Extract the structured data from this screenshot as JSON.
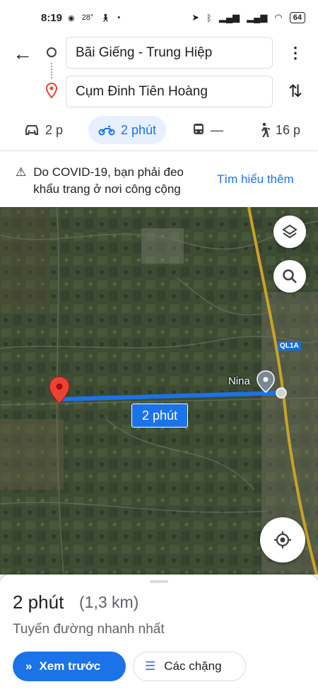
{
  "status_bar": {
    "time": "8:19",
    "temperature": "28°",
    "battery": "64"
  },
  "route": {
    "origin": "Bãi Giếng - Trung Hiệp",
    "destination": "Cụm Đinh Tiên Hoàng"
  },
  "travel_modes": [
    {
      "mode": "car",
      "label": "2 p",
      "icon": "car-icon",
      "active": false
    },
    {
      "mode": "motorbike",
      "label": "2 phút",
      "icon": "motorbike-icon",
      "active": true
    },
    {
      "mode": "transit",
      "label": "—",
      "icon": "transit-icon",
      "active": false
    },
    {
      "mode": "walk",
      "label": "16 p",
      "icon": "walk-icon",
      "active": false
    }
  ],
  "notice": {
    "text": "Do COVID-19, bạn phải đeo khẩu trang ở nơi công cộng",
    "link": "Tìm hiểu thêm"
  },
  "map": {
    "route_label": "2 phút",
    "place_label": "Nina",
    "road_label": "QL1A",
    "route_color": "#1a73e8",
    "pin_color": "#ea4335"
  },
  "summary": {
    "duration": "2 phút",
    "distance": "(1,3 km)",
    "description": "Tuyến đường nhanh nhất",
    "preview_button": "Xem trước",
    "steps_button": "Các chặng"
  }
}
